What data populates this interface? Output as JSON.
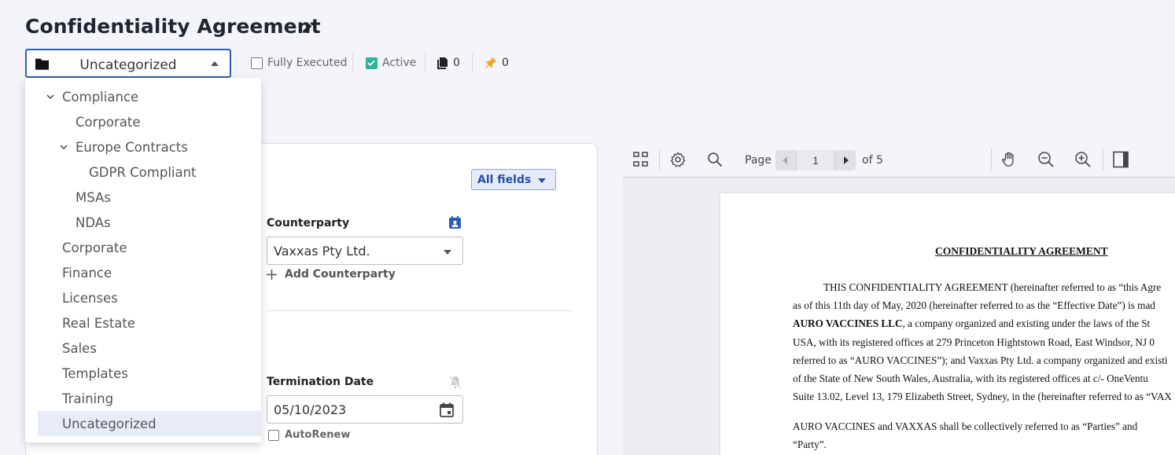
{
  "header": {
    "title": "Confidentiality Agreement",
    "category": "Uncategorized",
    "flags": {
      "fully_executed": "Fully Executed",
      "fully_executed_checked": false,
      "active": "Active",
      "active_checked": true,
      "documents_count": "0",
      "pins_count": "0"
    }
  },
  "category_dropdown": {
    "items": [
      {
        "label": "Compliance",
        "level": 1,
        "expanded": true
      },
      {
        "label": "Corporate",
        "level": 2
      },
      {
        "label": "Europe Contracts",
        "level": 2,
        "expanded": true
      },
      {
        "label": "GDPR Compliant",
        "level": 3
      },
      {
        "label": "MSAs",
        "level": 2
      },
      {
        "label": "NDAs",
        "level": 2
      },
      {
        "label": "Corporate",
        "level": 1
      },
      {
        "label": "Finance",
        "level": 1
      },
      {
        "label": "Licenses",
        "level": 1
      },
      {
        "label": "Real Estate",
        "level": 1
      },
      {
        "label": "Sales",
        "level": 1
      },
      {
        "label": "Templates",
        "level": 1
      },
      {
        "label": "Training",
        "level": 1
      },
      {
        "label": "Uncategorized",
        "level": 1,
        "selected": true
      }
    ]
  },
  "form": {
    "all_fields_label": "All fields",
    "counterparty_label": "Counterparty",
    "counterparty_value": "Vaxxas Pty Ltd.",
    "add_counterparty": "Add Counterparty",
    "termination_label": "Termination Date",
    "termination_value": "05/10/2023",
    "autorenew_label": "AutoRenew"
  },
  "viewer": {
    "page_label": "Page",
    "page_number": "1",
    "page_total": "of 5",
    "doc_title": "CONFIDENTIALITY AGREEMENT",
    "lines": [
      "THIS CONFIDENTIALITY AGREEMENT (hereinafter referred to as “this Agre",
      "as of this 11th day of May, 2020 (hereinafter referred to as the “Effective Date”) is mad",
      "AURO VACCINES LLC",
      ", a company organized and existing under the laws of the St",
      "USA, with its registered offices at 279 Princeton Hightstown Road, East Windsor, NJ 0",
      "referred to as “AURO VACCINES”); and Vaxxas Pty Ltd. a company organized and existi",
      "of the State of New South Wales, Australia, with its registered offices at c/- OneVentu",
      "Suite 13.02, Level 13, 179 Elizabeth Street, Sydney, in the (hereinafter referred to as “VAX",
      "AURO VACCINES and VAXXAS shall be collectively referred to as “Parties” and",
      "“Party”."
    ]
  },
  "colors": {
    "accent": "#2f5fb6",
    "active_check": "#2fb39a",
    "pin": "#f0a42a",
    "counterparty_icon": "#2e5db5"
  }
}
